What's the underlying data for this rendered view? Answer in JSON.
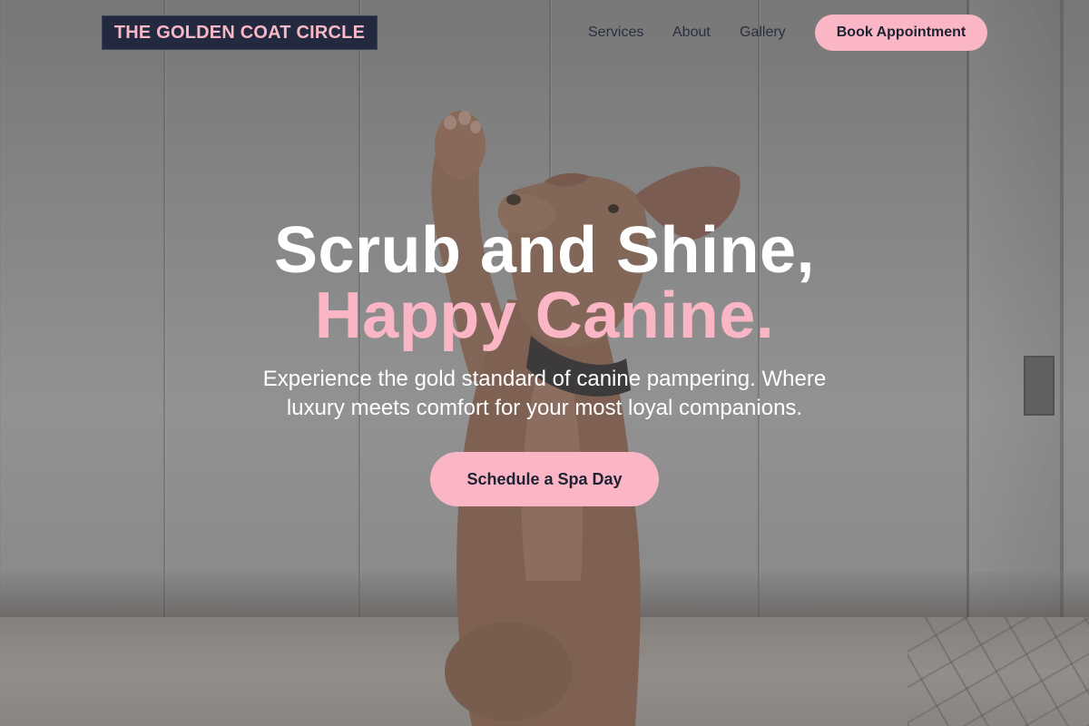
{
  "brand": {
    "name": "THE GOLDEN COAT CIRCLE"
  },
  "nav": {
    "links": [
      {
        "label": "Services"
      },
      {
        "label": "About"
      },
      {
        "label": "Gallery"
      }
    ],
    "cta_label": "Book Appointment"
  },
  "hero": {
    "title_line1": "Scrub and Shine,",
    "title_line2": "Happy Canine.",
    "subtitle": "Experience the gold standard of canine pampering. Where luxury meets comfort for your most loyal companions.",
    "cta_label": "Schedule a Spa Day",
    "background_image": "dog-raising-paw-photo"
  },
  "colors": {
    "accent_pink": "#fbb6c5",
    "logo_bg": "#232a40",
    "text_dark": "#1f2233"
  }
}
